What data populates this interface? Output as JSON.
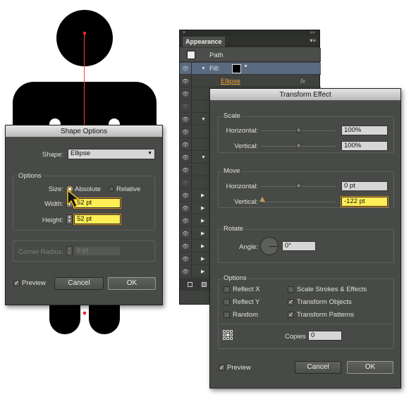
{
  "shape_options": {
    "title": "Shape Options",
    "shape_label": "Shape:",
    "shape_value": "Ellipse",
    "options_group": "Options",
    "size_label": "Size:",
    "absolute_label": "Absolute",
    "relative_label": "Relative",
    "width_label": "Width:",
    "width_value": "52 pt",
    "height_label": "Height:",
    "height_value": "52 pt",
    "corner_radius_label": "Corner Radius:",
    "corner_radius_value": "9 pt",
    "preview_label": "Preview",
    "cancel_label": "Cancel",
    "ok_label": "OK"
  },
  "appearance_panel": {
    "close_glyph": "×",
    "collapse_glyph": "««",
    "tab_label": "Appearance",
    "menu_glyph": "▾≡",
    "path_label": "Path",
    "fill_label": "Fill:",
    "effect_label": "Ellipse",
    "fx_glyph": "fx"
  },
  "transform_effect": {
    "title": "Transform Effect",
    "scale_group": "Scale",
    "scale_horizontal_label": "Horizontal:",
    "scale_horizontal_value": "100%",
    "scale_vertical_label": "Vertical:",
    "scale_vertical_value": "100%",
    "move_group": "Move",
    "move_horizontal_label": "Horizontal:",
    "move_horizontal_value": "0 pt",
    "move_vertical_label": "Vertical:",
    "move_vertical_value": "-122 pt",
    "rotate_group": "Rotate",
    "angle_label": "Angle:",
    "angle_value": "0°",
    "options_group": "Options",
    "reflect_x": "Reflect X",
    "reflect_y": "Reflect Y",
    "random": "Random",
    "scale_strokes": "Scale Strokes & Effects",
    "transform_objects": "Transform Objects",
    "transform_patterns": "Transform Patterns",
    "copies_label": "Copies",
    "copies_value": "0",
    "preview_label": "Preview",
    "cancel_label": "Cancel",
    "ok_label": "OK"
  },
  "colors": {
    "dialog_bg": "#474a46",
    "highlight_field": "#ffee55",
    "accent_orange": "#f0a53a",
    "guide_red": "#ff3b3b"
  }
}
